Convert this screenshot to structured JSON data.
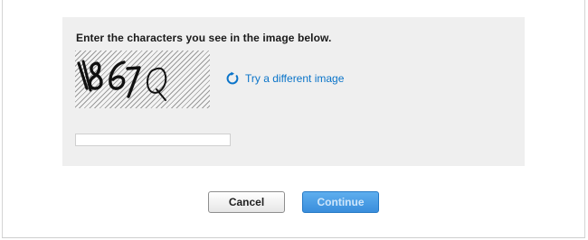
{
  "captcha": {
    "prompt": "Enter the characters you see in the image below.",
    "refresh_label": "Try a different image",
    "answer_value": ""
  },
  "buttons": {
    "cancel_label": "Cancel",
    "continue_label": "Continue"
  },
  "colors": {
    "link": "#0a74c9",
    "panel_background": "#efefef",
    "continue_button": "#3a8edc"
  }
}
